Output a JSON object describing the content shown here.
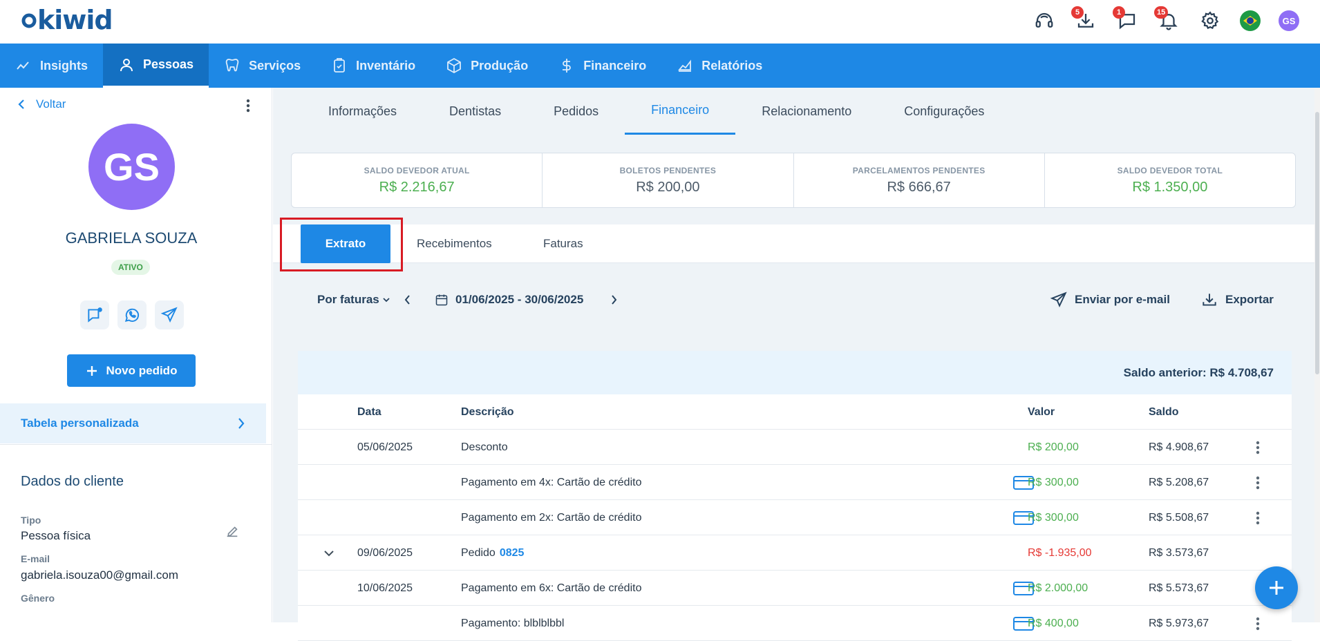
{
  "app": {
    "logo_text": "kiwid"
  },
  "topbar": {
    "download_badge": "5",
    "chat_badge": "1",
    "bell_badge": "15",
    "user_initials": "GS"
  },
  "nav": {
    "items": [
      {
        "label": "Insights",
        "icon": "chart-line-icon"
      },
      {
        "label": "Pessoas",
        "icon": "person-icon"
      },
      {
        "label": "Serviços",
        "icon": "tooth-icon"
      },
      {
        "label": "Inventário",
        "icon": "clipboard-icon"
      },
      {
        "label": "Produção",
        "icon": "box-icon"
      },
      {
        "label": "Financeiro",
        "icon": "dollar-icon"
      },
      {
        "label": "Relatórios",
        "icon": "area-chart-icon"
      }
    ],
    "active": "Pessoas"
  },
  "client": {
    "back_label": "Voltar",
    "initials": "GS",
    "name": "GABRIELA SOUZA",
    "status": "ATIVO",
    "new_order_label": "Novo pedido",
    "price_table_label": "Tabela personalizada",
    "section_title": "Dados do cliente",
    "fields": [
      {
        "label": "Tipo",
        "value": "Pessoa física"
      },
      {
        "label": "E-mail",
        "value": "gabriela.isouza00@gmail.com"
      },
      {
        "label": "Gênero",
        "value": ""
      }
    ]
  },
  "subtabs": [
    "Informações",
    "Dentistas",
    "Pedidos",
    "Financeiro",
    "Relacionamento",
    "Configurações"
  ],
  "summary": [
    {
      "label": "SALDO DEVEDOR ATUAL",
      "value": "R$ 2.216,67",
      "color": "#4caf50"
    },
    {
      "label": "BOLETOS PENDENTES",
      "value": "R$ 200,00",
      "color": "#4d5b69"
    },
    {
      "label": "PARCELAMENTOS PENDENTES",
      "value": "R$ 666,67",
      "color": "#4d5b69"
    },
    {
      "label": "SALDO DEVEDOR TOTAL",
      "value": "R$ 1.350,00",
      "color": "#4caf50"
    }
  ],
  "statement_tabs": [
    "Extrato",
    "Recebimentos",
    "Faturas"
  ],
  "toolbar": {
    "group_by": "Por faturas",
    "date_range": "01/06/2025 - 30/06/2025",
    "email_label": "Enviar por e-mail",
    "export_label": "Exportar"
  },
  "statement": {
    "previous_balance": "Saldo anterior: R$ 4.708,67",
    "columns": {
      "date": "Data",
      "description": "Descrição",
      "value": "Valor",
      "balance": "Saldo"
    },
    "rows": [
      {
        "date": "05/06/2025",
        "description": "Desconto",
        "order": "",
        "value": "R$ 200,00",
        "value_color": "green",
        "balance": "R$ 4.908,67",
        "card_icon": false,
        "menu": true,
        "expand": false
      },
      {
        "date": "",
        "description": "Pagamento em 4x: Cartão de crédito",
        "order": "",
        "value": "R$ 300,00",
        "value_color": "green",
        "balance": "R$ 5.208,67",
        "card_icon": true,
        "menu": true,
        "expand": false
      },
      {
        "date": "",
        "description": "Pagamento em 2x: Cartão de crédito",
        "order": "",
        "value": "R$ 300,00",
        "value_color": "green",
        "balance": "R$ 5.508,67",
        "card_icon": true,
        "menu": true,
        "expand": false
      },
      {
        "date": "09/06/2025",
        "description": "Pedido",
        "order": "0825",
        "value": "R$ -1.935,00",
        "value_color": "red",
        "balance": "R$ 3.573,67",
        "card_icon": false,
        "menu": false,
        "expand": true
      },
      {
        "date": "10/06/2025",
        "description": "Pagamento em 6x: Cartão de crédito",
        "order": "",
        "value": "R$ 2.000,00",
        "value_color": "green",
        "balance": "R$ 5.573,67",
        "card_icon": true,
        "menu": true,
        "expand": false
      },
      {
        "date": "",
        "description": "Pagamento: blblblbbl",
        "order": "",
        "value": "R$ 400,00",
        "value_color": "green",
        "balance": "R$ 5.973,67",
        "card_icon": true,
        "menu": true,
        "expand": false
      }
    ]
  }
}
